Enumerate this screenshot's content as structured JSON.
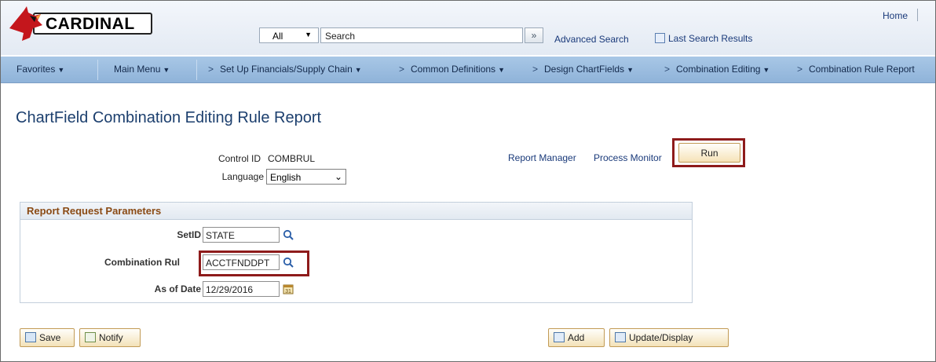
{
  "header": {
    "logo_text": "CARDINAL",
    "search_scope": "All",
    "search_placeholder": "Search",
    "search_go_glyph": "»",
    "advanced_search": "Advanced Search",
    "last_search_results": "Last Search Results",
    "home": "Home"
  },
  "nav": {
    "items": [
      {
        "label": "Favorites",
        "has_dropdown": true
      },
      {
        "label": "Main Menu",
        "has_dropdown": true
      },
      {
        "label": "Set Up Financials/Supply Chain",
        "has_dropdown": true
      },
      {
        "label": "Common Definitions",
        "has_dropdown": true
      },
      {
        "label": "Design ChartFields",
        "has_dropdown": true
      },
      {
        "label": "Combination Editing",
        "has_dropdown": true
      },
      {
        "label": "Combination Rule Report",
        "has_dropdown": false
      }
    ]
  },
  "page": {
    "title": "ChartField Combination Editing Rule Report",
    "control_id_label": "Control ID",
    "control_id_value": "COMBRUL",
    "language_label": "Language",
    "language_value": "English",
    "report_manager": "Report Manager",
    "process_monitor": "Process Monitor",
    "run_button": "Run"
  },
  "params": {
    "header": "Report Request Parameters",
    "setid_label": "SetID",
    "setid_value": "STATE",
    "combination_rule_label": "Combination Rul",
    "combination_rule_value": "ACCTFNDDPT",
    "as_of_date_label": "As of Date",
    "as_of_date_value": "12/29/2016"
  },
  "footer": {
    "save": "Save",
    "notify": "Notify",
    "add": "Add",
    "update_display": "Update/Display"
  },
  "colors": {
    "highlight": "#8e1b1b",
    "navbar": "#9cbde0",
    "title": "#1c3f6e",
    "link": "#1a3a7a"
  },
  "icons": [
    "cardinal-bird-icon",
    "lookup-magnifier-icon",
    "calendar-icon",
    "save-icon",
    "notify-icon",
    "add-icon",
    "update-icon"
  ]
}
